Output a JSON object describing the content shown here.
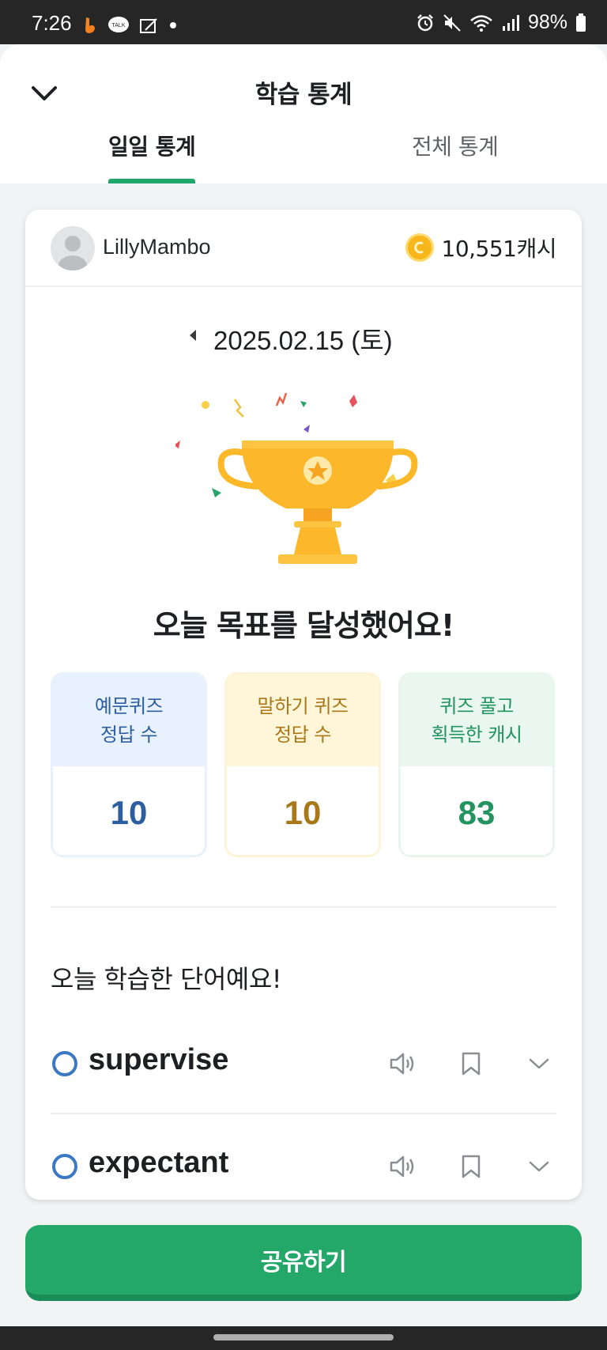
{
  "status_bar": {
    "time": "7:26",
    "battery": "98%"
  },
  "header": {
    "title": "학습 통계",
    "tabs": [
      {
        "label": "일일 통계",
        "active": true
      },
      {
        "label": "전체 통계",
        "active": false
      }
    ]
  },
  "user": {
    "name": "LillyMambo",
    "cash": "10,551캐시"
  },
  "date": {
    "label": "2025.02.15 (토)"
  },
  "achievement": {
    "message": "오늘 목표를 달성했어요!"
  },
  "stats": [
    {
      "label_line1": "예문퀴즈",
      "label_line2": "정답 수",
      "value": "10",
      "color": "#2d5e9f"
    },
    {
      "label_line1": "말하기 퀴즈",
      "label_line2": "정답 수",
      "value": "10",
      "color": "#a87819"
    },
    {
      "label_line1": "퀴즈 풀고",
      "label_line2": "획득한 캐시",
      "value": "83",
      "color": "#23945f"
    }
  ],
  "words": {
    "heading": "오늘 학습한 단어예요!",
    "items": [
      {
        "word": "supervise"
      },
      {
        "word": "expectant"
      }
    ]
  },
  "share_button": {
    "label": "공유하기"
  },
  "colors": {
    "accent": "#23a86a",
    "coin": "#f7b71c",
    "word_marker": "#3a78c4"
  }
}
